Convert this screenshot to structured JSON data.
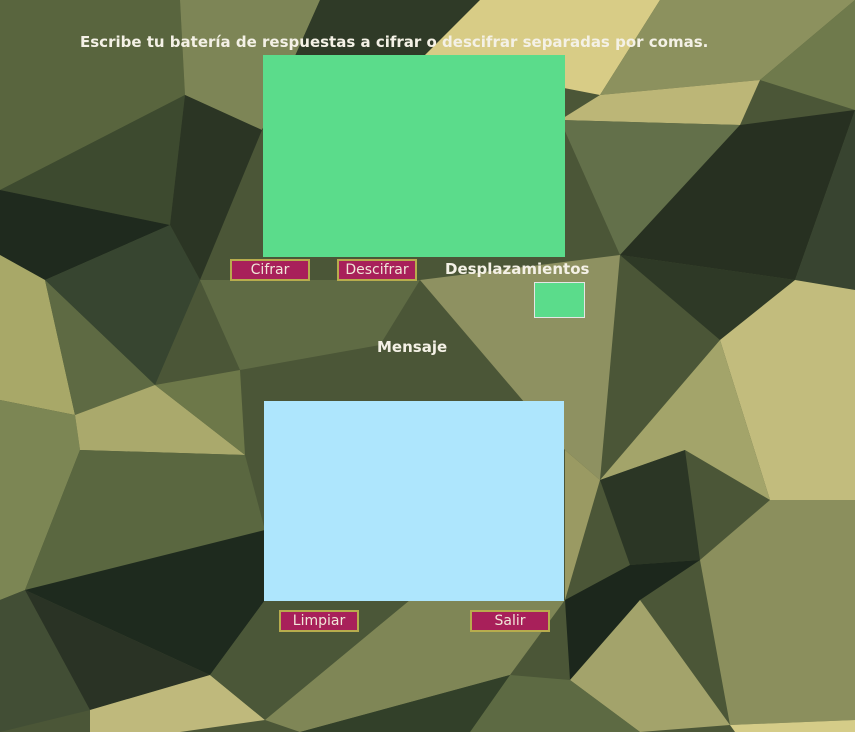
{
  "instructions": "Escribe tu batería de respuestas a cifrar o descifrar separadas por comas.",
  "input_area": {
    "value": "",
    "color": "#5bdc8b"
  },
  "buttons": {
    "cifrar": "Cifrar",
    "descifrar": "Descifrar",
    "limpiar": "Limpiar",
    "salir": "Salir"
  },
  "shift": {
    "label": "Desplazamientos",
    "value": "",
    "color": "#5bdc8b"
  },
  "message": {
    "label": "Mensaje",
    "value": "",
    "color": "#aee6fd"
  },
  "colors": {
    "button_bg": "#a8205a",
    "button_border": "#b7ac4d",
    "label_text": "#f4f1e6"
  }
}
